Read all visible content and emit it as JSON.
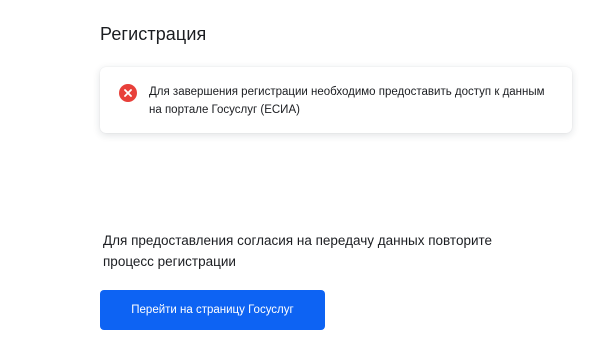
{
  "page": {
    "title": "Регистрация"
  },
  "alert": {
    "icon": "error-circle-x-icon",
    "icon_color": "#e8403a",
    "message": "Для завершения регистрации необходимо предоставить доступ к данным на портале Госуслуг (ЕСИА)"
  },
  "info": {
    "text": "Для предоставления согласия на передачу данных повторите процесс регистрации"
  },
  "action": {
    "button_label": "Перейти на страницу Госуслуг",
    "button_color": "#0d63f3"
  }
}
